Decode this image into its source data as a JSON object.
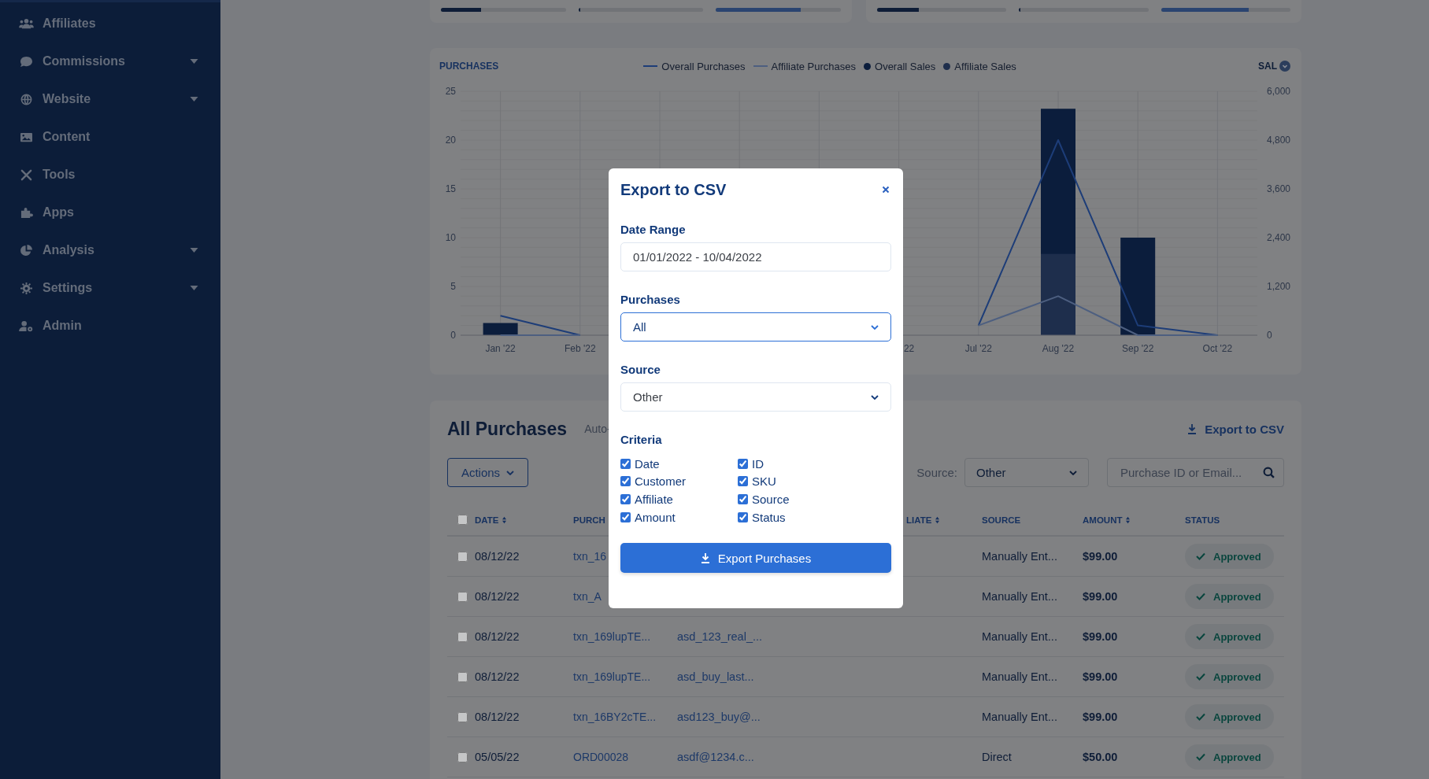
{
  "sidebar": {
    "items": [
      {
        "label": "Affiliates",
        "has_submenu": false
      },
      {
        "label": "Commissions",
        "has_submenu": true
      },
      {
        "label": "Website",
        "has_submenu": true
      },
      {
        "label": "Content",
        "has_submenu": false
      },
      {
        "label": "Tools",
        "has_submenu": false
      },
      {
        "label": "Apps",
        "has_submenu": false
      },
      {
        "label": "Analysis",
        "has_submenu": true
      },
      {
        "label": "Settings",
        "has_submenu": true
      },
      {
        "label": "Admin",
        "has_submenu": false
      }
    ]
  },
  "stat_cards": [
    {
      "bars": [
        {
          "level": 0.32
        },
        {
          "level": 0
        },
        {
          "level": 0.68
        }
      ]
    },
    {
      "bars": [
        {
          "level": 0.32
        },
        {
          "level": 0
        },
        {
          "level": 0.68
        }
      ]
    }
  ],
  "chart": {
    "purchases_chart": {
      "chart_data": {
        "type": "line",
        "ylabel": "PURCHASES",
        "categories": [
          "Jan '22",
          "Feb '22",
          null,
          null,
          null,
          "22",
          "Jul '22",
          "Aug '22",
          "Sep '22",
          "Oct '22"
        ],
        "ylim": [
          0,
          25
        ],
        "yticks": [
          0,
          5,
          10,
          15,
          20,
          25
        ],
        "series": [
          {
            "name": "Overall Purchases",
            "color": "#1d3d78",
            "values": [
              2,
              0,
              null,
              null,
              null,
              null,
              1,
              20,
              1,
              0
            ]
          },
          {
            "name": "Affiliate Purchases",
            "color": "#4d5f80",
            "values": [
              0,
              0,
              null,
              null,
              null,
              null,
              1,
              4,
              0,
              0
            ]
          }
        ]
      }
    },
    "sales_chart": {
      "chart_data": {
        "type": "bar",
        "ylabel": "SAL",
        "stacked": false,
        "grid": true,
        "ylim": [
          0,
          6000
        ],
        "yticks": [
          {
            "value": 0,
            "label": "0"
          },
          {
            "value": 1200,
            "label": "1,200"
          },
          {
            "value": 2400,
            "label": "2,400"
          },
          {
            "value": 3600,
            "label": "3,600"
          },
          {
            "value": 4800,
            "label": "4,800"
          },
          {
            "value": 6000,
            "label": "6,000"
          }
        ],
        "series": [
          {
            "name": "Overall Sales",
            "color": "#0b1d3c",
            "values": [
              300,
              0,
              null,
              null,
              null,
              null,
              0,
              5570,
              2400,
              0
            ]
          },
          {
            "name": "Affiliate Sales",
            "color": "#1e2e4c",
            "values": [
              0,
              0,
              null,
              null,
              null,
              null,
              0,
              2000,
              0,
              0
            ]
          }
        ]
      }
    }
  },
  "purchases": {
    "title": "All Purchases",
    "subtitle": "Auto-",
    "export_link": "Export to CSV",
    "actions_button": "Actions",
    "source_label": "Source:",
    "source_value": "Other",
    "search": {
      "placeholder": "Purchase ID or Email..."
    },
    "select_all_checked": false,
    "columns": [
      {
        "label": "DATE",
        "sortable": true
      },
      {
        "label": "PURCH",
        "sortable": false
      },
      null,
      {
        "label": "LIATE",
        "sortable": true
      },
      {
        "label": "SOURCE",
        "sortable": false
      },
      {
        "label": "AMOUNT",
        "sortable": true
      },
      {
        "label": "STATUS",
        "sortable": false
      }
    ],
    "rows": [
      {
        "checked": false,
        "date": "08/12/22",
        "purchase_id": "txn_16",
        "source": "Manually Ent...",
        "amount": "$99.00",
        "status": "Approved"
      },
      {
        "checked": false,
        "date": "08/12/22",
        "purchase_id": "txn_A",
        "source": "Manually Ent...",
        "amount": "$99.00",
        "status": "Approved"
      },
      {
        "checked": false,
        "date": "08/12/22",
        "purchase_id": "txn_169lupTE...",
        "customer": "asd_123_real_...",
        "source": "Manually Ent...",
        "amount": "$99.00",
        "status": "Approved"
      },
      {
        "checked": false,
        "date": "08/12/22",
        "purchase_id": "txn_169lupTE...",
        "customer": "asd_buy_last...",
        "source": "Manually Ent...",
        "amount": "$99.00",
        "status": "Approved"
      },
      {
        "checked": false,
        "date": "08/12/22",
        "purchase_id": "txn_16BY2cTE...",
        "customer": "asd123_buy@...",
        "source": "Manually Ent...",
        "amount": "$99.00",
        "status": "Approved"
      },
      {
        "checked": false,
        "date": "05/05/22",
        "purchase_id": "ORD00028",
        "customer": "asdf@1234.c...",
        "source": "Direct",
        "amount": "$50.00",
        "status": "Approved"
      }
    ]
  },
  "modal": {
    "title": "Export to CSV",
    "fields": [
      {
        "kind": "text",
        "label": "Date Range",
        "value": "01/01/2022 - 10/04/2022",
        "focused": false
      },
      {
        "kind": "select",
        "label": "Purchases",
        "value": "All",
        "focused": true
      },
      {
        "kind": "select",
        "label": "Source",
        "value": "Other",
        "focused": false
      }
    ],
    "criteria_label": "Criteria",
    "criteria": [
      {
        "label": "Date",
        "checked": true
      },
      {
        "label": "ID",
        "checked": true
      },
      {
        "label": "Customer",
        "checked": true
      },
      {
        "label": "SKU",
        "checked": true
      },
      {
        "label": "Affiliate",
        "checked": true
      },
      {
        "label": "Source",
        "checked": true
      },
      {
        "label": "Amount",
        "checked": true
      },
      {
        "label": "Status",
        "checked": true
      }
    ],
    "button": "Export Purchases"
  }
}
